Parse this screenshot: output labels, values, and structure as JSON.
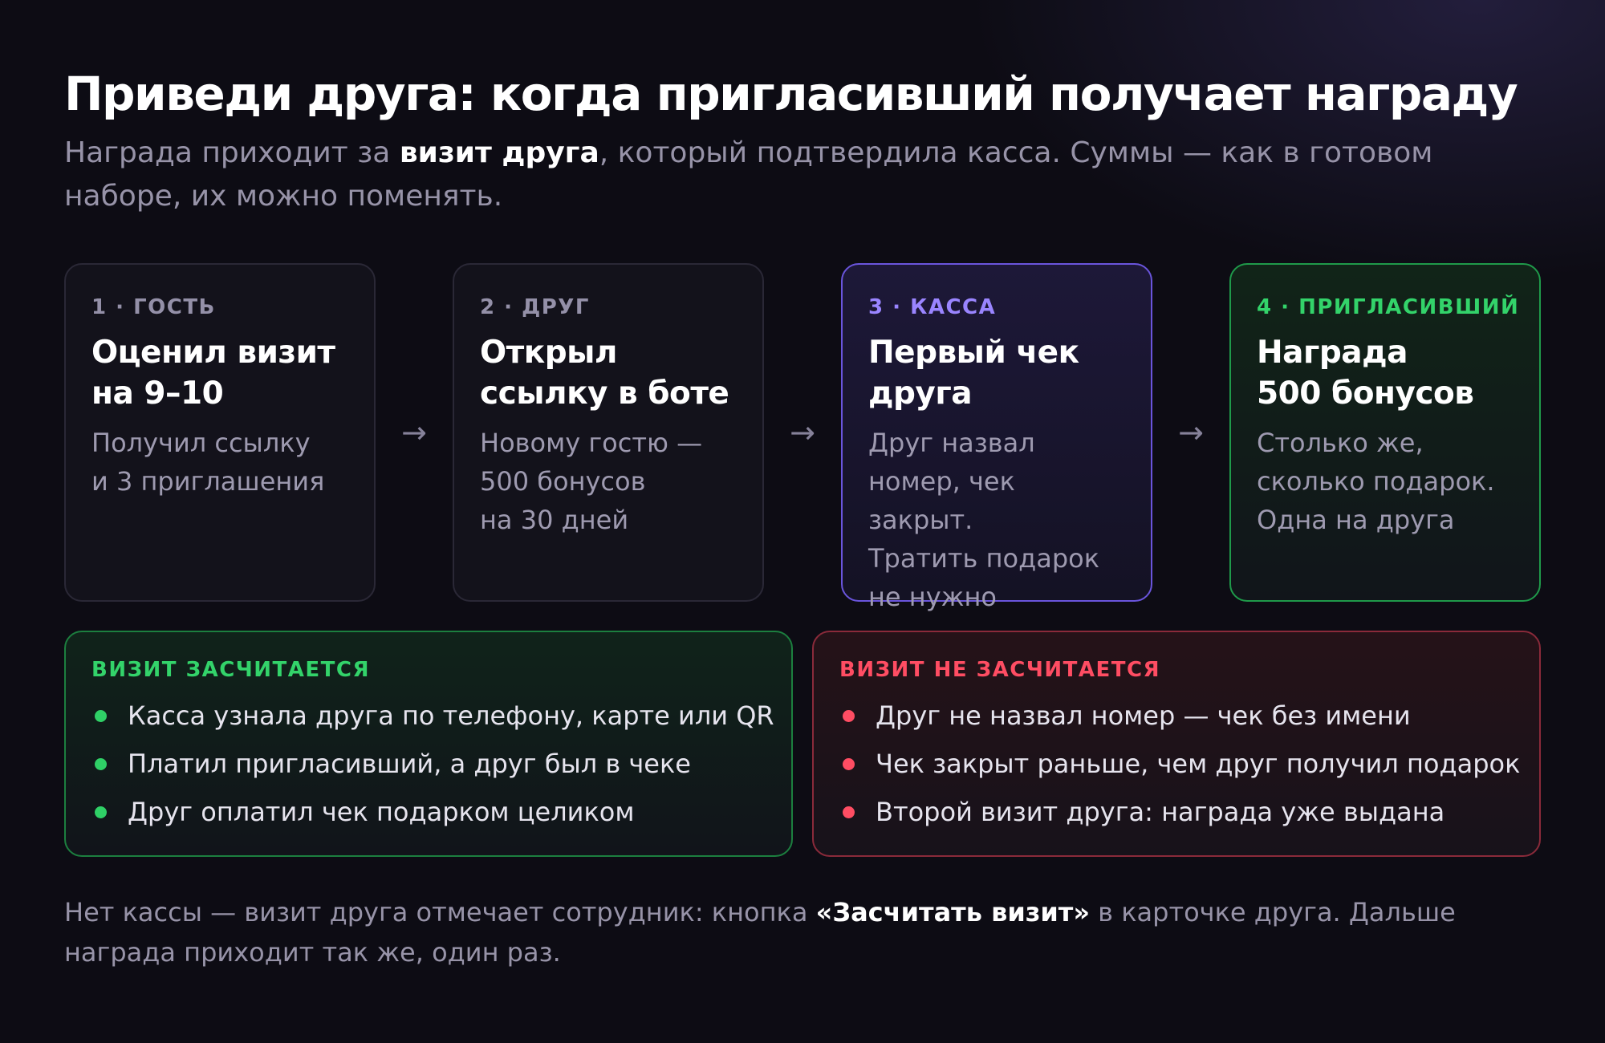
{
  "header": {
    "title": "Приведи друга: когда пригласивший получает награду",
    "subtitle_before": "Награда приходит за ",
    "subtitle_bold": "визит друга",
    "subtitle_after": ", который подтвердила касса. Суммы — как в готовом наборе, их можно поменять."
  },
  "steps": [
    {
      "label": "1 · ГОСТЬ",
      "title": "Оценил визит\nна 9–10",
      "description": "Получил ссылку\nи 3 приглашения"
    },
    {
      "label": "2 · ДРУГ",
      "title": "Открыл\nссылку в боте",
      "description": "Новому гостю —\n500 бонусов\nна 30 дней"
    },
    {
      "label": "3 · КАССА",
      "title": "Первый чек\nдруга",
      "description": "Друг назвал\nномер, чек закрыт.\nТратить подарок\nне нужно"
    },
    {
      "label": "4 · ПРИГЛАСИВШИЙ",
      "title": "Награда\n500 бонусов",
      "description": "Столько же,\nсколько подарок.\nОдна на друга"
    }
  ],
  "arrow_symbol": "→",
  "rules": {
    "counts": {
      "label": "ВИЗИТ ЗАСЧИТАЕТСЯ",
      "items": [
        "Касса узнала друга по телефону, карте или QR",
        "Платил пригласивший, а друг был в чеке",
        "Друг оплатил чек подарком целиком"
      ]
    },
    "not_counts": {
      "label": "ВИЗИТ НЕ ЗАСЧИТАЕТСЯ",
      "items": [
        "Друг не назвал номер — чек без имени",
        "Чек закрыт раньше, чем друг получил подарок",
        "Второй визит друга: награда уже выдана"
      ]
    }
  },
  "footer": {
    "before": "Нет кассы — визит друга отмечает сотрудник: кнопка ",
    "bold": "«Засчитать визит»",
    "after": " в карточке друга. Дальше награда приходит так же, один раз."
  },
  "colors": {
    "background": "#0d0c14",
    "accent_purple": "#9a85ff",
    "accent_green": "#33d36a",
    "accent_red": "#ff4d63"
  }
}
